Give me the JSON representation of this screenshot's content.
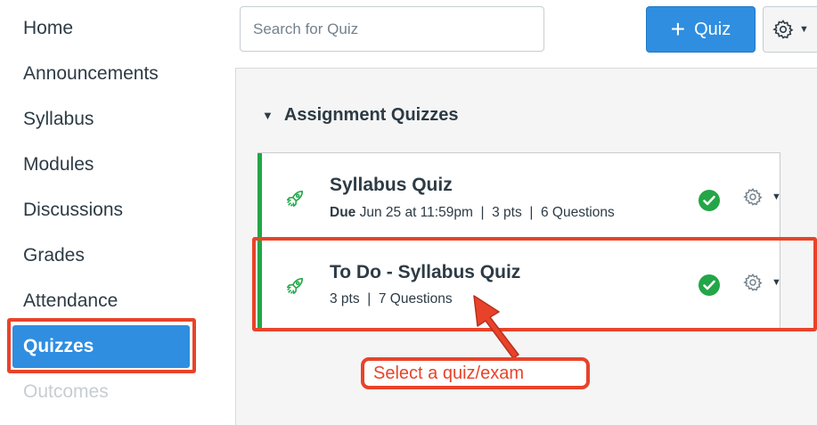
{
  "sidebar": {
    "items": [
      {
        "label": "Home"
      },
      {
        "label": "Announcements"
      },
      {
        "label": "Syllabus"
      },
      {
        "label": "Modules"
      },
      {
        "label": "Discussions"
      },
      {
        "label": "Grades"
      },
      {
        "label": "Attendance"
      },
      {
        "label": "Quizzes",
        "active": true
      },
      {
        "label": "Outcomes",
        "disabled": true
      }
    ]
  },
  "toolbar": {
    "search_placeholder": "Search for Quiz",
    "search_value": "",
    "add_quiz_icon": "plus-icon",
    "add_quiz_label": "Quiz",
    "settings_icon": "gear-icon"
  },
  "group": {
    "title": "Assignment Quizzes"
  },
  "quizzes": [
    {
      "title": "Syllabus Quiz",
      "due_label": "Due",
      "due_date": "Jun 25 at 11:59pm",
      "points": "3 pts",
      "questions": "6 Questions",
      "published": true
    },
    {
      "title": "To Do - Syllabus Quiz",
      "points": "3 pts",
      "questions": "7 Questions",
      "published": true
    }
  ],
  "annotation": {
    "callout_text": "Select a quiz/exam"
  },
  "colors": {
    "accent": "#2f8ee0",
    "published": "#22a647",
    "annotation": "#e8432a"
  }
}
